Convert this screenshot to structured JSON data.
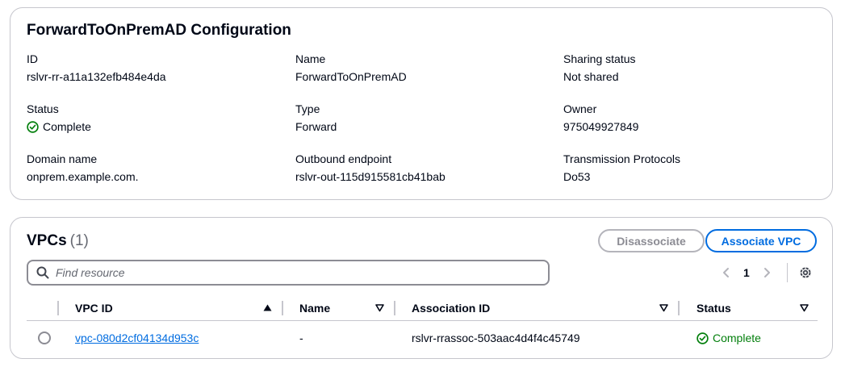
{
  "config": {
    "title": "ForwardToOnPremAD Configuration",
    "fields": {
      "id": {
        "label": "ID",
        "value": "rslvr-rr-a11a132efb484e4da"
      },
      "name": {
        "label": "Name",
        "value": "ForwardToOnPremAD"
      },
      "sharing": {
        "label": "Sharing status",
        "value": "Not shared"
      },
      "status": {
        "label": "Status",
        "value": "Complete"
      },
      "type": {
        "label": "Type",
        "value": "Forward"
      },
      "owner": {
        "label": "Owner",
        "value": "975049927849"
      },
      "domain": {
        "label": "Domain name",
        "value": "onprem.example.com."
      },
      "outbound": {
        "label": "Outbound endpoint",
        "value": "rslvr-out-115d915581cb41bab"
      },
      "protocols": {
        "label": "Transmission Protocols",
        "value": "Do53"
      }
    }
  },
  "vpcs": {
    "title": "VPCs",
    "count": "(1)",
    "disassociate_label": "Disassociate",
    "associate_label": "Associate VPC",
    "search_placeholder": "Find resource",
    "current_page": "1",
    "columns": {
      "vpc_id": "VPC ID",
      "name": "Name",
      "association_id": "Association ID",
      "status": "Status"
    },
    "rows": [
      {
        "vpc_id": "vpc-080d2cf04134d953c",
        "name": "-",
        "association_id": "rslvr-rrassoc-503aac4d4f4c45749",
        "status": "Complete"
      }
    ]
  },
  "colors": {
    "success": "#037f0c",
    "link": "#006ce0",
    "border": "#c6c6cd"
  },
  "icons": [
    "status-success-icon",
    "search-icon",
    "chevron-left-icon",
    "chevron-right-icon",
    "settings-gear-icon",
    "sort-ascending-icon",
    "sort-descending-icon"
  ]
}
